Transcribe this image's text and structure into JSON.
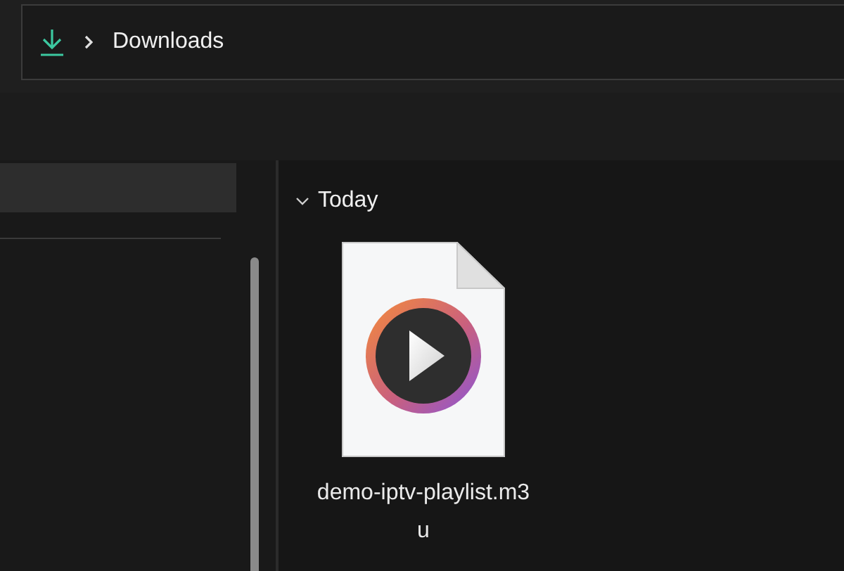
{
  "address_bar": {
    "breadcrumb": [
      "Downloads"
    ]
  },
  "group": {
    "label": "Today",
    "expanded": true
  },
  "files": [
    {
      "name": "demo-iptv-playlist.m3u"
    }
  ]
}
